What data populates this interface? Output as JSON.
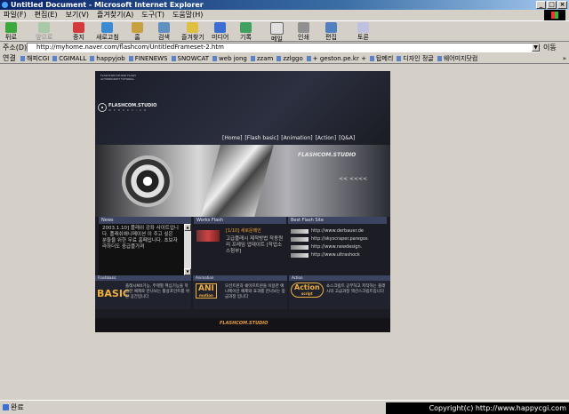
{
  "window": {
    "title": "Untitled Document - Microsoft Internet Explorer",
    "buttons": [
      "_",
      "□",
      "×"
    ]
  },
  "menu": [
    "파일(F)",
    "편집(E)",
    "보기(V)",
    "즐겨찾기(A)",
    "도구(T)",
    "도움말(H)"
  ],
  "toolbar": {
    "back": "뒤로",
    "forward": "앞으로",
    "stop": "중지",
    "refresh": "새로고침",
    "home": "홈",
    "search": "검색",
    "favorites": "즐겨찾기",
    "media": "미디어",
    "history": "기록",
    "mail": "메일",
    "print": "인쇄",
    "edit": "편집",
    "discuss": "토론"
  },
  "address": {
    "label": "주소(D)",
    "url": "http://myhome.naver.com/flashcom/UntitledFrameset-2.htm",
    "go": "이동"
  },
  "links": {
    "label": "연결",
    "items": [
      "해피CGI",
      "CGIMALL",
      "happyjob",
      "FINENEWS",
      "SNOWCAT",
      "web jong",
      "zzam",
      "zzlggo",
      "+ geston.pe.kr +",
      "탑메리",
      "디자인 정글",
      "웨어미지닷컴"
    ],
    "more": "»"
  },
  "site": {
    "tiny": "FLASHCOM STUDIO FLASH ACTIONSCRIPT TUTORIAL",
    "logo": {
      "name": "FLASHCOM.STUDIO",
      "tag": "W E B   D E S I G N"
    },
    "nav": [
      "[Home]",
      "[Flash basic]",
      "[Animation]",
      "[Action]",
      "[Q&A]"
    ],
    "banner_brand": "FLASHCOM.STUDIO",
    "banner_arrows": "<< <<<<",
    "news": {
      "title": "News",
      "text": "2003.1.10] 플래쉬 강좌 사이트입니다. 플래쉬애니메이션 이 주고 싶은 분들을 위한 무료 홈페입니다. 초보자라하더도 중급플가져"
    },
    "works": {
      "title": "Works Flash",
      "item_title": "[1/10] 새로운메인",
      "item_text": "고급플래시 제작방법 작동원리 프레임 업데이트 [작업소스첨부]"
    },
    "best": {
      "title": "Best Flash Site",
      "sites": [
        "http://www.derbauer.de",
        "http://skyscraper.paregos",
        "http://www.newdesign.",
        "http://www.ultrashock"
      ]
    },
    "bottom": [
      {
        "head": "Flashbasic",
        "label": "BASIC",
        "desc": "플래시MX기능, 주제별 핵심기능을 학습한 예제로 만나보는 활용포인트를 위한 공간입니다"
      },
      {
        "head": "Animation",
        "label": "ANI",
        "sub": "motion",
        "desc": "모션트윈과 쉐이프트윈을 이용한 애니메이션 예제와 효과를 만나보는 중급과정 입니다"
      },
      {
        "head": "Action",
        "label": "Action",
        "sub": "script",
        "desc": "쇼스크립트 공부하고 저작하는 플래시의 고급과정 액션스크립트입니다"
      }
    ],
    "footer": "FLASHCOM.STUDIO"
  },
  "status": {
    "text": "완료",
    "copyright": "Copyright(c) http://www.happycgi.com"
  },
  "colors": {
    "titlebar": "#0a246a",
    "site_bg": "#1c1c24",
    "section_header": "#3b4460",
    "accent_orange": "#f0a030"
  }
}
